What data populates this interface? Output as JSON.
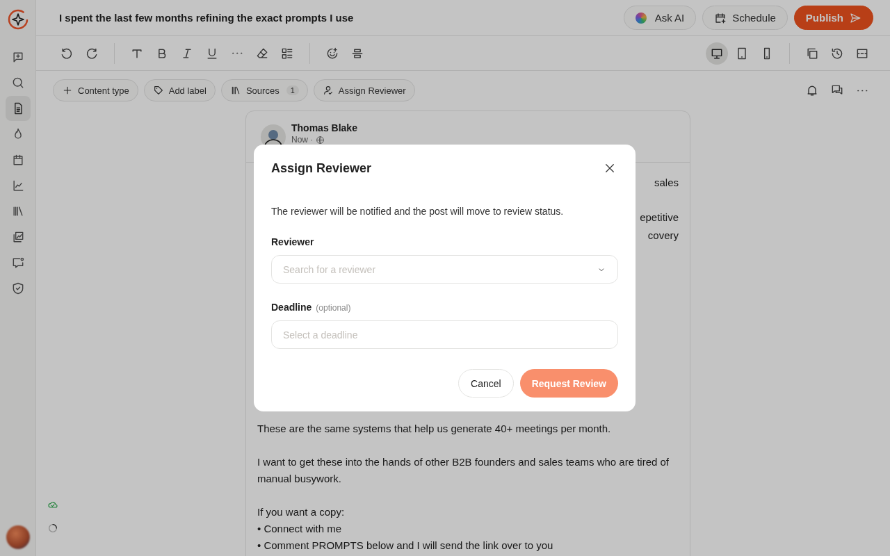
{
  "title": "I spent the last few months refining the exact prompts I use",
  "header_actions": [
    {
      "label": "Ask AI",
      "kind": "ai"
    },
    {
      "label": "Schedule",
      "kind": "schedule"
    },
    {
      "label": "Publish",
      "kind": "publish"
    }
  ],
  "sidebar": {
    "items": [
      {
        "selected": false
      },
      {
        "selected": false
      },
      {
        "selected": true
      },
      {
        "selected": false
      },
      {
        "selected": false
      },
      {
        "selected": false
      },
      {
        "selected": false
      },
      {
        "selected": false
      },
      {
        "selected": false
      },
      {
        "selected": false
      }
    ]
  },
  "view_modes": [
    {
      "selected": true
    },
    {
      "selected": false
    },
    {
      "selected": false
    }
  ],
  "chips": [
    {
      "label": "Content type"
    },
    {
      "label": "Add label"
    },
    {
      "label": "Sources",
      "count": "1"
    },
    {
      "label": "Assign Reviewer"
    }
  ],
  "post": {
    "author": "Thomas Blake",
    "meta": "Now ·",
    "cut_lines": [
      "sales",
      "epetitive",
      "covery"
    ],
    "paragraphs": [
      [
        "These are the same systems that help us generate 40+ meetings per month."
      ],
      [
        "I want to get these into the hands of other B2B founders and sales teams who are tired of manual busywork."
      ],
      [
        "If you want a copy:",
        "• Connect with me",
        "• Comment PROMPTS below and I will send the link over to you"
      ]
    ]
  },
  "modal": {
    "title": "Assign Reviewer",
    "description": "The reviewer will be notified and the post will move to review status.",
    "reviewer_label": "Reviewer",
    "reviewer_placeholder": "Search for a reviewer",
    "deadline_label": "Deadline",
    "deadline_hint": "(optional)",
    "deadline_placeholder": "Select a deadline",
    "cancel": "Cancel",
    "submit": "Request Review"
  }
}
